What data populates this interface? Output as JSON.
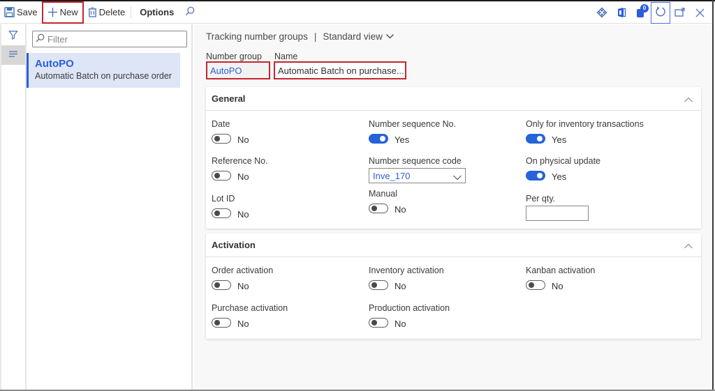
{
  "toolbar": {
    "save_label": "Save",
    "new_label": "New",
    "delete_label": "Delete",
    "options_label": "Options",
    "right_icons": [
      "connector-icon",
      "office-icon",
      "notifications-icon",
      "refresh-icon",
      "open-new-window-icon",
      "close-icon"
    ],
    "notification_count": "0"
  },
  "leftstrip": {
    "items": [
      {
        "icon": "filter-icon"
      },
      {
        "icon": "list-icon",
        "active": true
      }
    ]
  },
  "listpane": {
    "filter_placeholder": "Filter",
    "items": [
      {
        "title": "AutoPO",
        "subtitle": "Automatic Batch on purchase order",
        "selected": true
      }
    ]
  },
  "main": {
    "breadcrumb": {
      "page": "Tracking number groups",
      "separator": "|",
      "view": "Standard view"
    },
    "header": {
      "number_group_label": "Number group",
      "number_group_value": "AutoPO",
      "name_label": "Name",
      "name_value": "Automatic Batch on purchase..."
    },
    "general": {
      "title": "General",
      "fields": {
        "date": {
          "label": "Date",
          "value": "No",
          "on": false
        },
        "reference_no": {
          "label": "Reference No.",
          "value": "No",
          "on": false
        },
        "lot_id": {
          "label": "Lot ID",
          "value": "No",
          "on": false
        },
        "number_sequence_no": {
          "label": "Number sequence No.",
          "value": "Yes",
          "on": true
        },
        "number_sequence_code": {
          "label": "Number sequence code",
          "value": "Inve_170"
        },
        "manual": {
          "label": "Manual",
          "value": "No",
          "on": false
        },
        "only_inventory": {
          "label": "Only for inventory transactions",
          "value": "Yes",
          "on": true
        },
        "on_physical_update": {
          "label": "On physical update",
          "value": "Yes",
          "on": true
        },
        "per_qty": {
          "label": "Per qty.",
          "value": ""
        }
      }
    },
    "activation": {
      "title": "Activation",
      "fields": {
        "order_activation": {
          "label": "Order activation",
          "value": "No",
          "on": false
        },
        "purchase_activation": {
          "label": "Purchase activation",
          "value": "No",
          "on": false
        },
        "inventory_activation": {
          "label": "Inventory activation",
          "value": "No",
          "on": false
        },
        "production_activation": {
          "label": "Production activation",
          "value": "No",
          "on": false
        },
        "kanban_activation": {
          "label": "Kanban activation",
          "value": "No",
          "on": false
        }
      }
    }
  },
  "colors": {
    "accent": "#2563d9",
    "highlight_border": "#c4262e",
    "selected_row_bg": "#dde5f6"
  }
}
